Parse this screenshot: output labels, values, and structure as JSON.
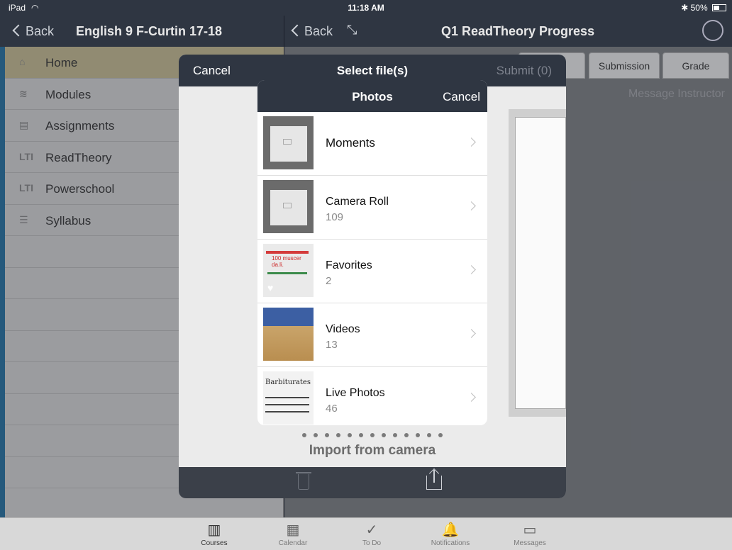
{
  "status": {
    "device": "iPad",
    "time": "11:18 AM",
    "battery": "50%"
  },
  "left_nav": {
    "back": "Back",
    "title": "English 9 F-Curtin 17-18"
  },
  "right_nav": {
    "back": "Back",
    "title": "Q1 ReadTheory Progress"
  },
  "menu": [
    {
      "label": "Home",
      "icon": "house-icon"
    },
    {
      "label": "Modules",
      "icon": "layers-icon"
    },
    {
      "label": "Assignments",
      "icon": "assignments-icon"
    },
    {
      "label": "ReadTheory",
      "icon": "lti-icon"
    },
    {
      "label": "Powerschool",
      "icon": "lti-icon"
    },
    {
      "label": "Syllabus",
      "icon": "list-icon"
    }
  ],
  "tabs": {
    "submission": "Submission",
    "grade": "Grade"
  },
  "message_instructor": "Message Instructor",
  "modal": {
    "cancel": "Cancel",
    "title": "Select file(s)",
    "submit": "Submit (0)",
    "import": "Import from camera"
  },
  "photos": {
    "title": "Photos",
    "cancel": "Cancel",
    "albums": [
      {
        "name": "Moments",
        "count": ""
      },
      {
        "name": "Camera Roll",
        "count": "109"
      },
      {
        "name": "Favorites",
        "count": "2"
      },
      {
        "name": "Videos",
        "count": "13"
      },
      {
        "name": "Live Photos",
        "count": "46"
      }
    ]
  },
  "tabbar": [
    "Courses",
    "Calendar",
    "To Do",
    "Notifications",
    "Messages"
  ],
  "thumb_text": {
    "paper": "Barbiturates",
    "favorites": "100 muscer da.li."
  },
  "colors": {
    "nav": "#2f3642",
    "accent": "#2472a4",
    "active_menu": "#c9bf94"
  }
}
